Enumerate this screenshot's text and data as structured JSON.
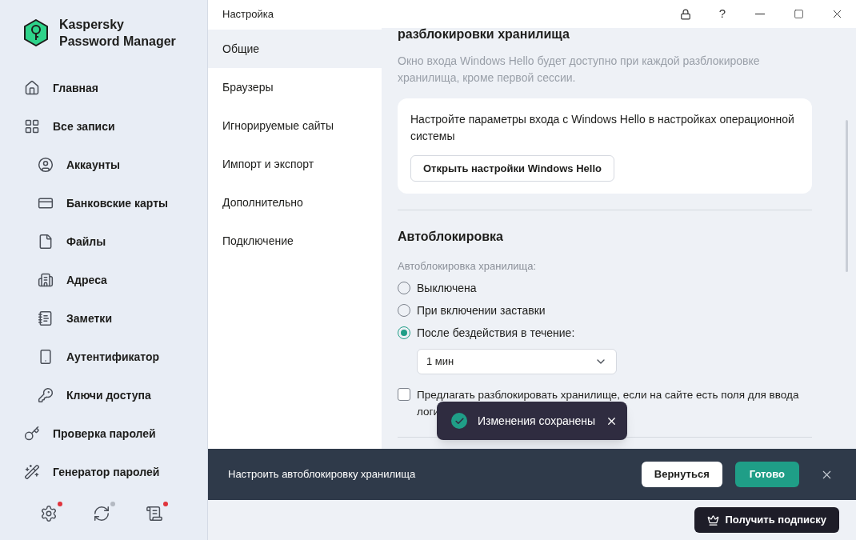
{
  "app": {
    "name_line1": "Kaspersky",
    "name_line2": "Password Manager"
  },
  "sidebar": {
    "items": [
      {
        "label": "Главная"
      },
      {
        "label": "Все записи",
        "children": [
          {
            "label": "Аккаунты"
          },
          {
            "label": "Банковские карты"
          },
          {
            "label": "Файлы"
          },
          {
            "label": "Адреса"
          },
          {
            "label": "Заметки"
          },
          {
            "label": "Аутентификатор"
          },
          {
            "label": "Ключи доступа"
          }
        ]
      },
      {
        "label": "Проверка паролей"
      },
      {
        "label": "Генератор паролей"
      }
    ],
    "footer_icons": [
      {
        "color": "#e0343c"
      },
      {
        "color": "#b4b9c2"
      },
      {
        "color": "#e0343c"
      }
    ]
  },
  "window": {
    "title": "Настройка",
    "help": "?"
  },
  "settings_nav": [
    {
      "label": "Общие",
      "selected": true
    },
    {
      "label": "Браузеры",
      "selected": false
    },
    {
      "label": "Игнорируемые сайты",
      "selected": false
    },
    {
      "label": "Импорт и экспорт",
      "selected": false
    },
    {
      "label": "Дополнительно",
      "selected": false
    },
    {
      "label": "Подключение",
      "selected": false
    }
  ],
  "content": {
    "heading_cut": "разблокировки хранилища",
    "description": "Окно входа Windows Hello будет доступно при каждой разблокировке хранилища, кроме первой сессии.",
    "hello_card": {
      "text": "Настройте параметры входа с Windows Hello в настройках операционной системы",
      "button": "Открыть настройки Windows Hello"
    },
    "autolock": {
      "title": "Автоблокировка",
      "label": "Автоблокировка хранилища:",
      "options": [
        {
          "label": "Выключена",
          "selected": false
        },
        {
          "label": "При включении заставки",
          "selected": false
        },
        {
          "label": "После бездействия в течение:",
          "selected": true
        }
      ],
      "dropdown": {
        "value": "1 мин"
      },
      "checkbox": {
        "label": "Предлагать разблокировать хранилище, если на сайте есть поля для ввода логи",
        "checked": false
      }
    }
  },
  "toast": {
    "text": "Изменения сохранены"
  },
  "banner": {
    "text": "Настроить автоблокировку хранилища",
    "back_button": "Вернуться",
    "done_button": "Готово"
  },
  "subscribe_button": "Получить подписку"
}
